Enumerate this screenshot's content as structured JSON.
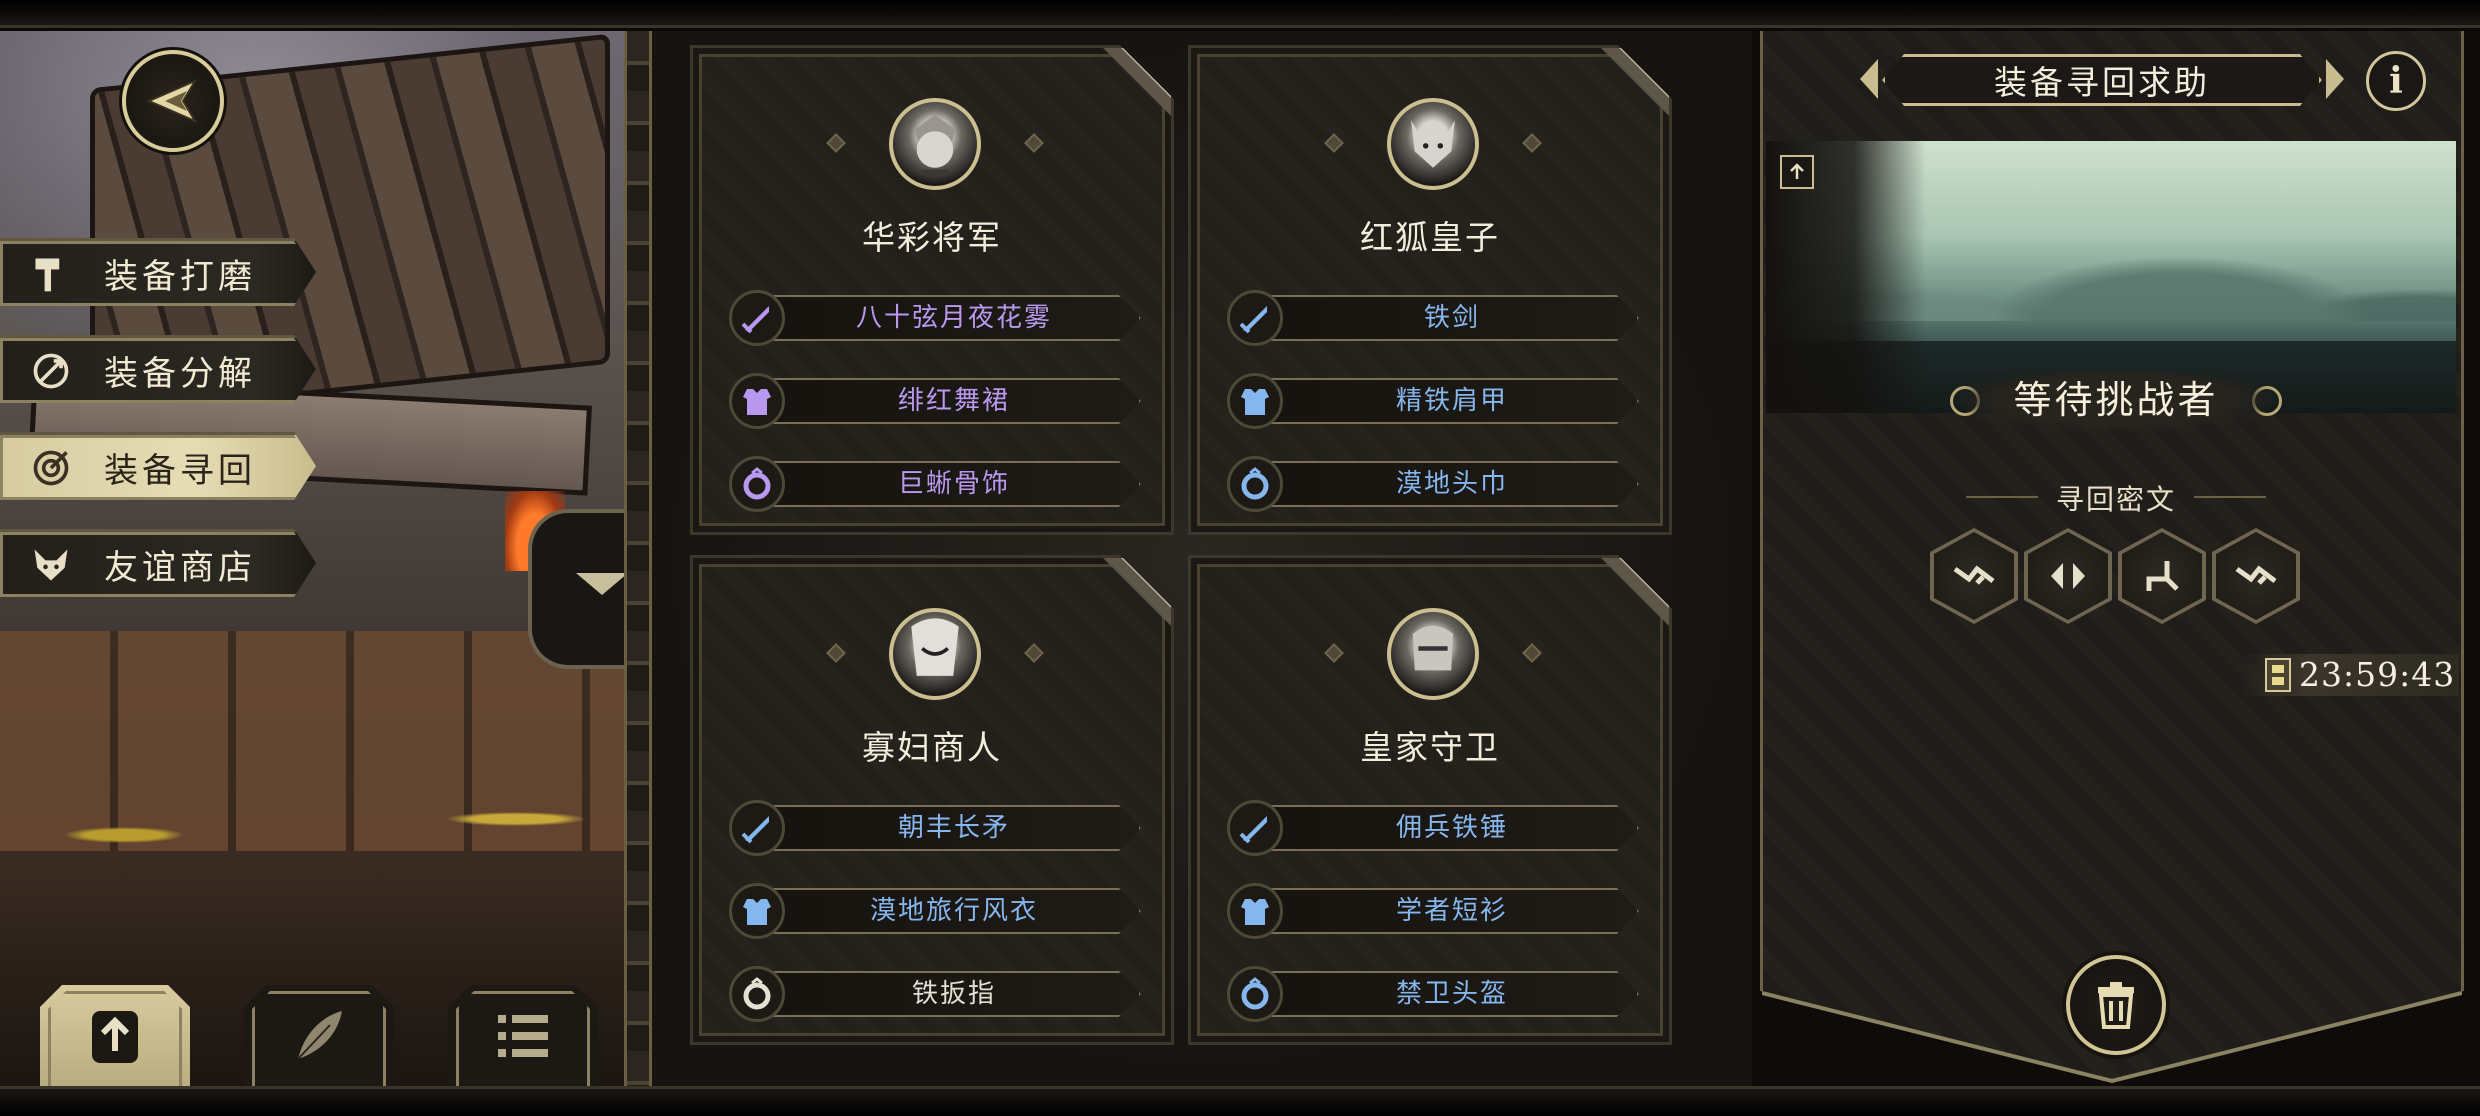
{
  "menu": {
    "items": [
      {
        "label": "装备打磨",
        "icon": "hammer-icon",
        "active": false
      },
      {
        "label": "装备分解",
        "icon": "dismantle-icon",
        "active": false
      },
      {
        "label": "装备寻回",
        "icon": "target-icon",
        "active": true
      },
      {
        "label": "友谊商店",
        "icon": "fox-icon",
        "active": false
      }
    ]
  },
  "bottom_tabs": [
    {
      "icon": "upload-file-icon",
      "active": true
    },
    {
      "icon": "feather-icon",
      "active": false
    },
    {
      "icon": "list-icon",
      "active": false
    }
  ],
  "cards": [
    {
      "name": "华彩将军",
      "items": [
        {
          "label": "八十弦月夜花雾",
          "type": "weapon",
          "rarity": "purple"
        },
        {
          "label": "绯红舞裙",
          "type": "armor",
          "rarity": "purple"
        },
        {
          "label": "巨蜥骨饰",
          "type": "ring",
          "rarity": "purple"
        }
      ]
    },
    {
      "name": "红狐皇子",
      "items": [
        {
          "label": "铁剑",
          "type": "weapon",
          "rarity": "blue"
        },
        {
          "label": "精铁肩甲",
          "type": "armor",
          "rarity": "blue"
        },
        {
          "label": "漠地头巾",
          "type": "ring",
          "rarity": "blue"
        }
      ]
    },
    {
      "name": "寡妇商人",
      "items": [
        {
          "label": "朝丰长矛",
          "type": "weapon",
          "rarity": "blue"
        },
        {
          "label": "漠地旅行风衣",
          "type": "armor",
          "rarity": "blue"
        },
        {
          "label": "铁扳指",
          "type": "ring",
          "rarity": "white"
        }
      ]
    },
    {
      "name": "皇家守卫",
      "items": [
        {
          "label": "佣兵铁锤",
          "type": "weapon",
          "rarity": "blue"
        },
        {
          "label": "学者短衫",
          "type": "armor",
          "rarity": "blue"
        },
        {
          "label": "禁卫头盔",
          "type": "ring",
          "rarity": "blue"
        }
      ]
    }
  ],
  "right_panel": {
    "title": "装备寻回求助",
    "status": "等待挑战者",
    "cipher_title": "寻回密文",
    "runes": [
      "rune-1-icon",
      "rune-2-icon",
      "rune-3-icon",
      "rune-1-icon"
    ],
    "timer": "23:59:43"
  },
  "colors": {
    "purple": "#b999f0",
    "blue": "#86b6ee",
    "white": "#e4e0d4",
    "gold_trim": "#c9bd90"
  }
}
